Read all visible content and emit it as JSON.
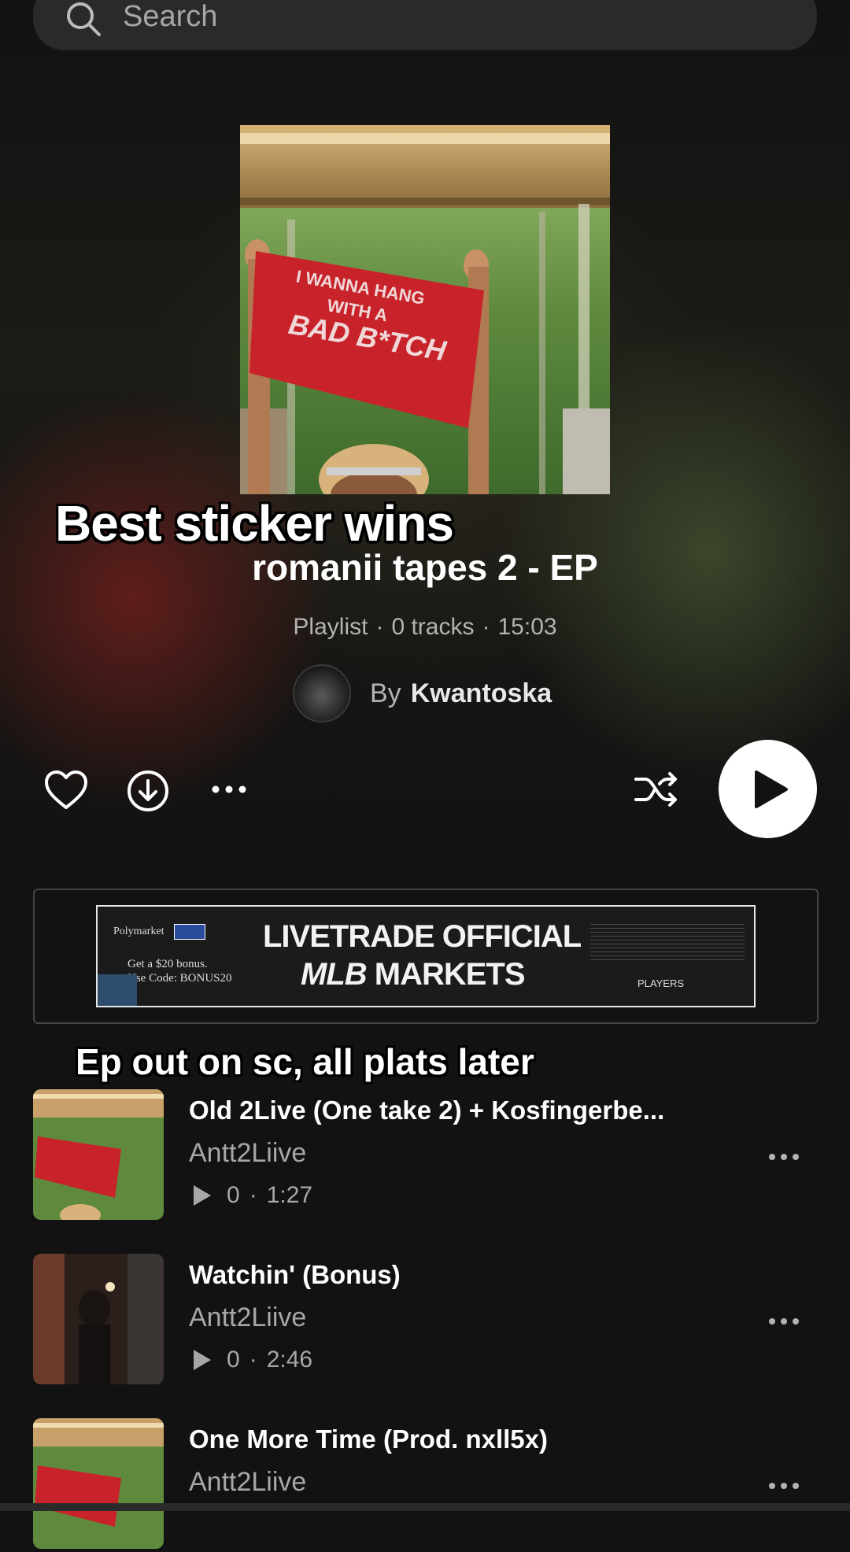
{
  "search": {
    "placeholder": "Search"
  },
  "overlay": {
    "sticker_top": "Best sticker wins",
    "sticker_mid": "Ep out on sc, all plats later"
  },
  "playlist": {
    "title": "romanii tapes 2 - EP",
    "type": "Playlist",
    "tracks_label": "0 tracks",
    "duration": "15:03",
    "by_label": "By",
    "owner": "Kwantoska",
    "cover_text": [
      "I WANNA HANG",
      "WITH A",
      "BAD B*TCH"
    ]
  },
  "controls": {
    "icons": [
      "heart-icon",
      "download-icon",
      "more-icon",
      "shuffle-icon",
      "play-icon"
    ]
  },
  "ad": {
    "brand": "Polymarket",
    "bonus_line1": "Get a $20 bonus.",
    "bonus_line2": "Use Code: BONUS20",
    "headline1": "LIVETRADE OFFICIAL",
    "headline2_a": "MLB",
    "headline2_b": "MARKETS",
    "footer": "PLAYERS"
  },
  "tracks": [
    {
      "title": "Old 2Live (One take 2) + Kosfingerbe...",
      "artist": "Antt2Liive",
      "plays": "0",
      "duration": "1:27"
    },
    {
      "title": "Watchin' (Bonus)",
      "artist": "Antt2Liive",
      "plays": "0",
      "duration": "2:46"
    },
    {
      "title": "One More Time (Prod. nxll5x)",
      "artist": "Antt2Liive"
    }
  ],
  "colors": {
    "background": "#121212",
    "text_secondary": "#b3b3b3",
    "cover_banner": "#c8232a"
  }
}
